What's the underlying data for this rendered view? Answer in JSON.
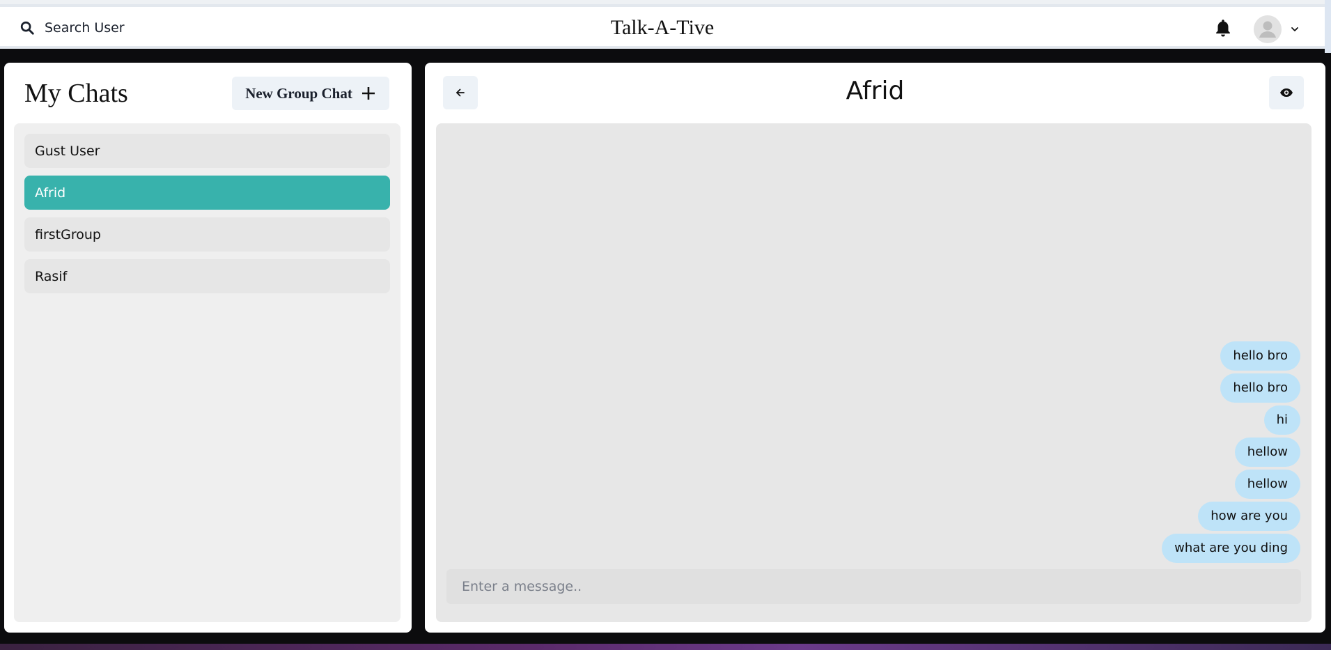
{
  "header": {
    "search_label": "Search User",
    "app_title": "Talk-A-Tive"
  },
  "sidebar": {
    "title": "My Chats",
    "new_group_label": "New Group Chat",
    "chats": [
      {
        "name": "Gust User",
        "active": false
      },
      {
        "name": "Afrid",
        "active": true
      },
      {
        "name": "firstGroup",
        "active": false
      },
      {
        "name": "Rasif",
        "active": false
      }
    ]
  },
  "chat": {
    "title": "Afrid",
    "messages": [
      "hello bro",
      "hello bro",
      "hi",
      "hellow",
      "hellow",
      "how are you",
      "what are you ding"
    ],
    "input_placeholder": "Enter a message..",
    "input_value": ""
  },
  "colors": {
    "accent": "#38b2ac",
    "bubble": "#bee3f8"
  },
  "icons": [
    "search-icon",
    "bell-icon",
    "avatar-icon",
    "chevron-down-icon",
    "plus-icon",
    "arrow-left-icon",
    "eye-icon"
  ]
}
